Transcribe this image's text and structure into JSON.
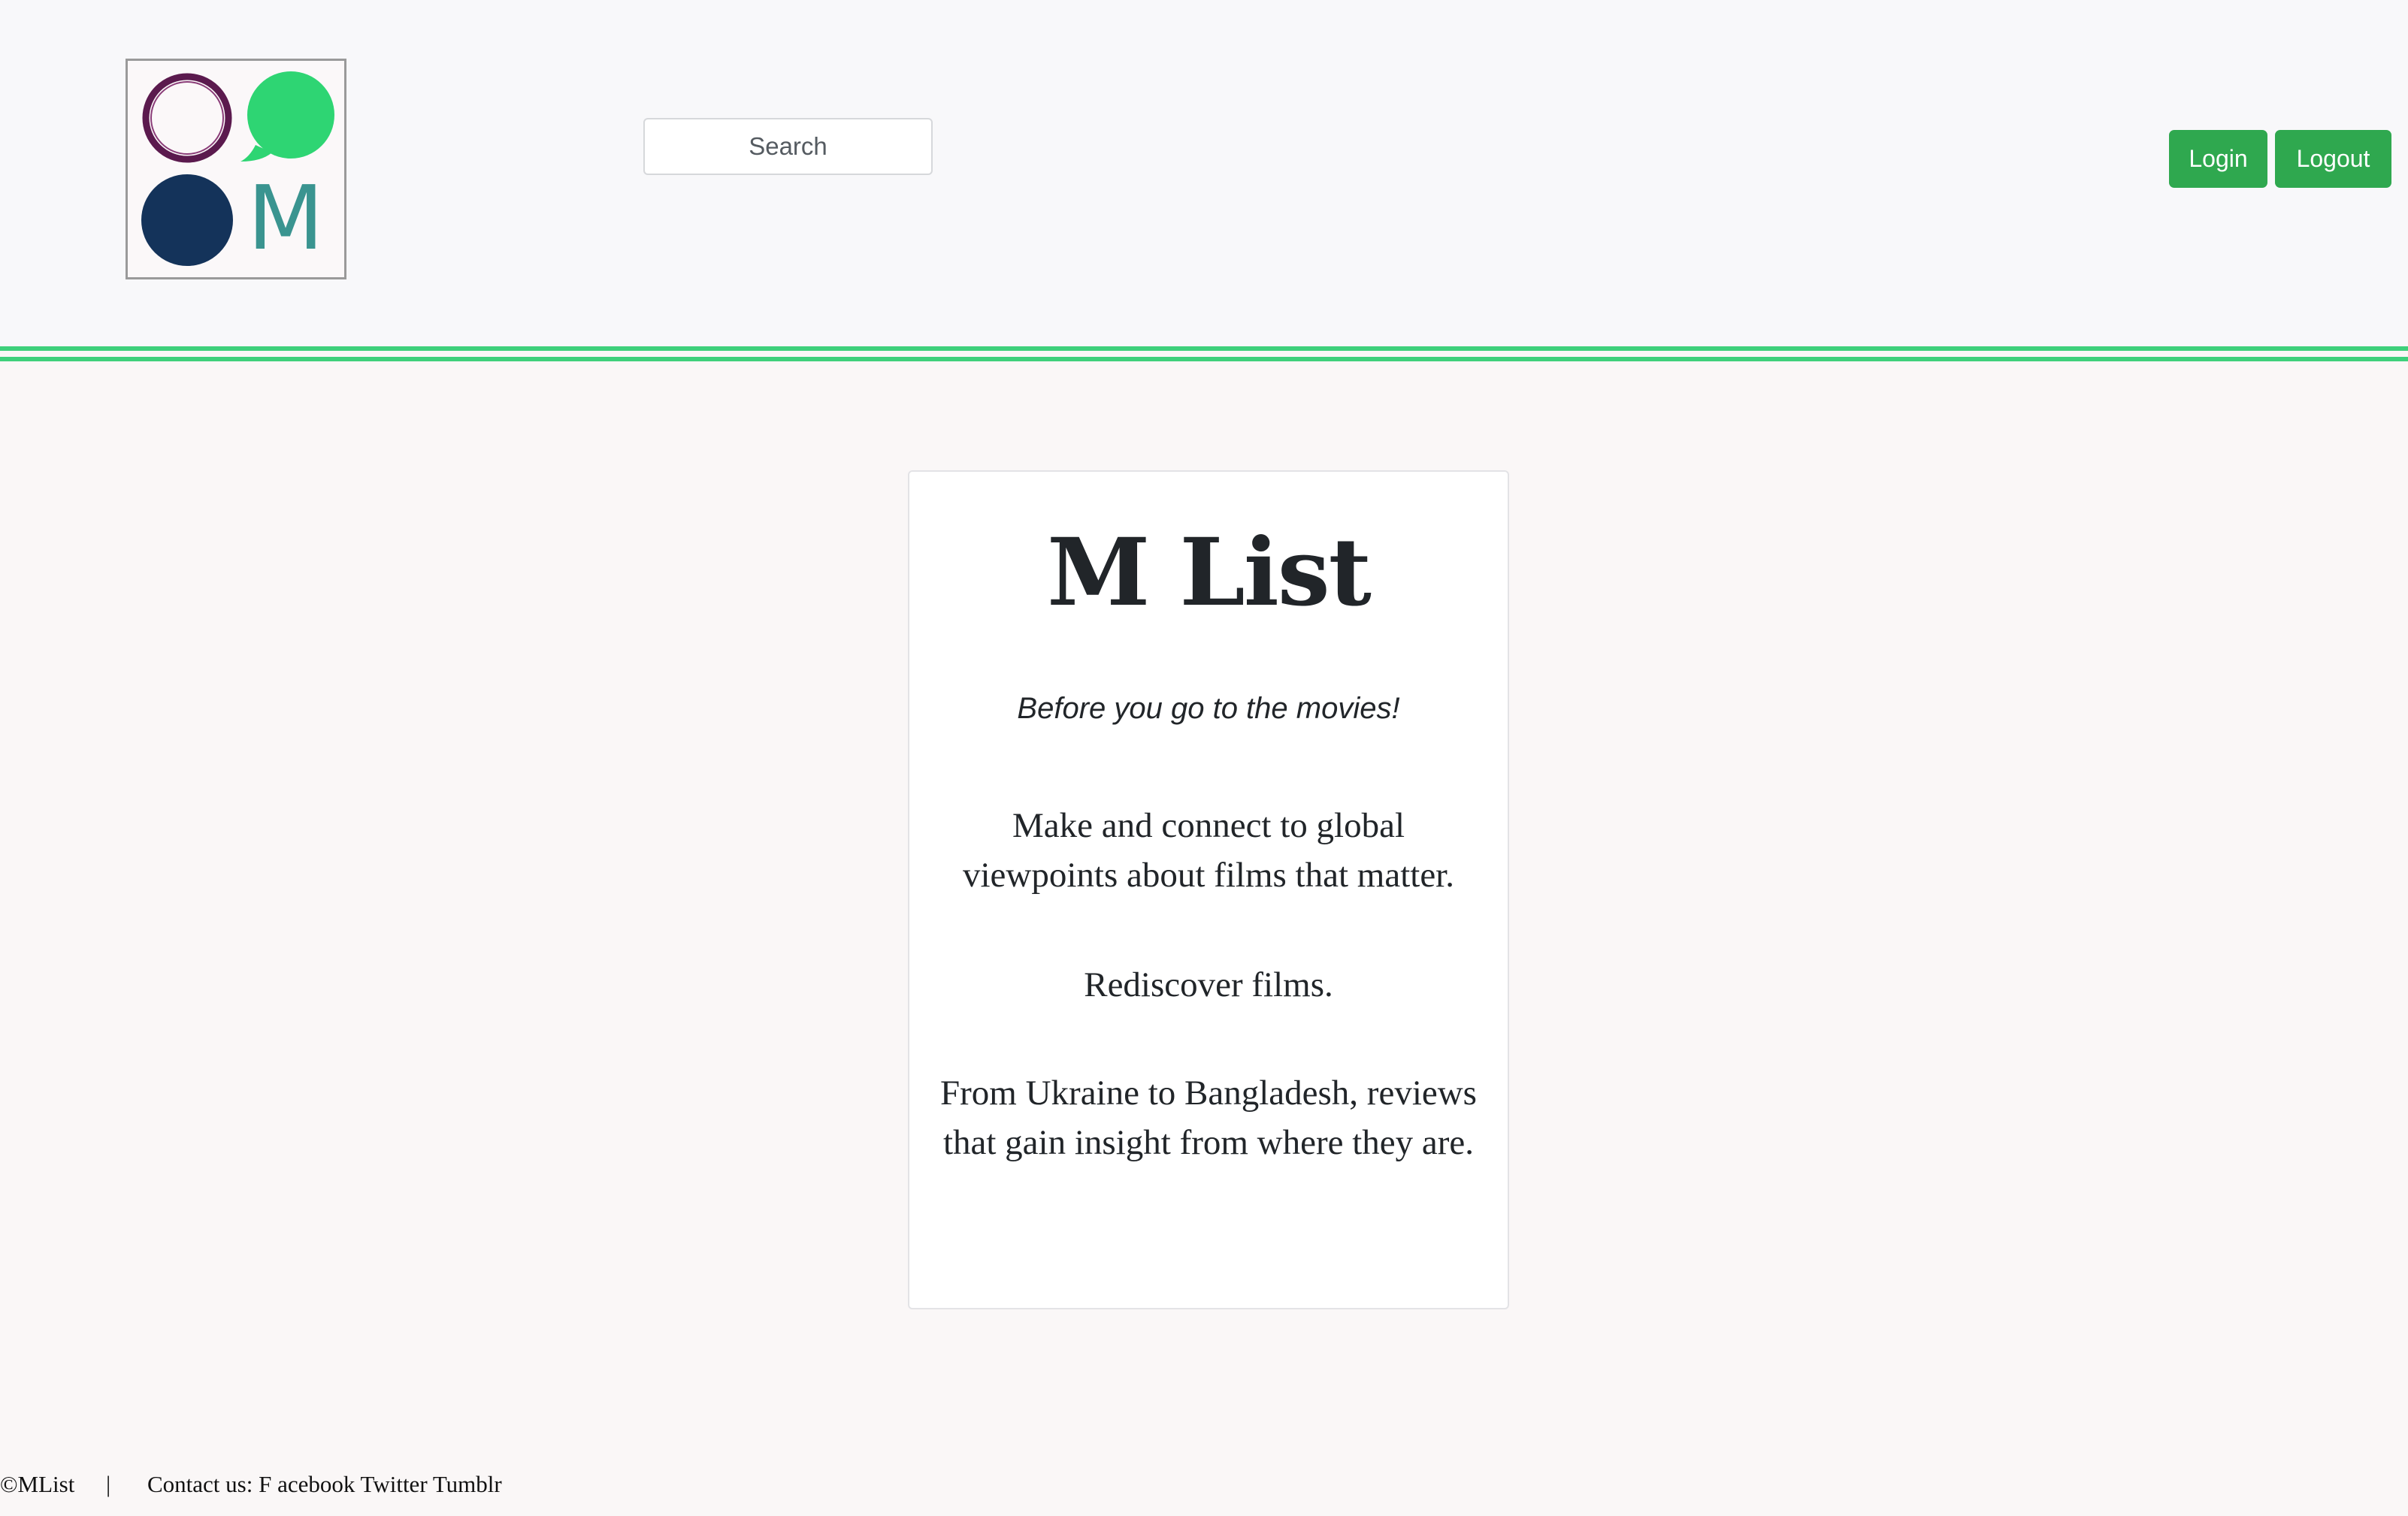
{
  "header": {
    "logo": {
      "letter": "M",
      "colors": {
        "ring": "#5b1a4e",
        "bubble": "#2ed573",
        "dot": "#14335a",
        "letter": "#3a9490"
      }
    },
    "search": {
      "placeholder": "Search"
    },
    "buttons": {
      "login": "Login",
      "logout": "Logout"
    },
    "accent_color": "#3ed07b",
    "button_color": "#2fa84f"
  },
  "card": {
    "title": "M List",
    "tagline": "Before you go to the movies!",
    "paragraphs": [
      "Make and connect to global viewpoints about films that matter.",
      "Rediscover films.",
      "From Ukraine to Bangladesh, reviews that gain insight from where they are."
    ]
  },
  "footer": {
    "copyright": "©MList",
    "separator": "|",
    "contact": "Contact us: F acebook Twitter Tumblr"
  }
}
